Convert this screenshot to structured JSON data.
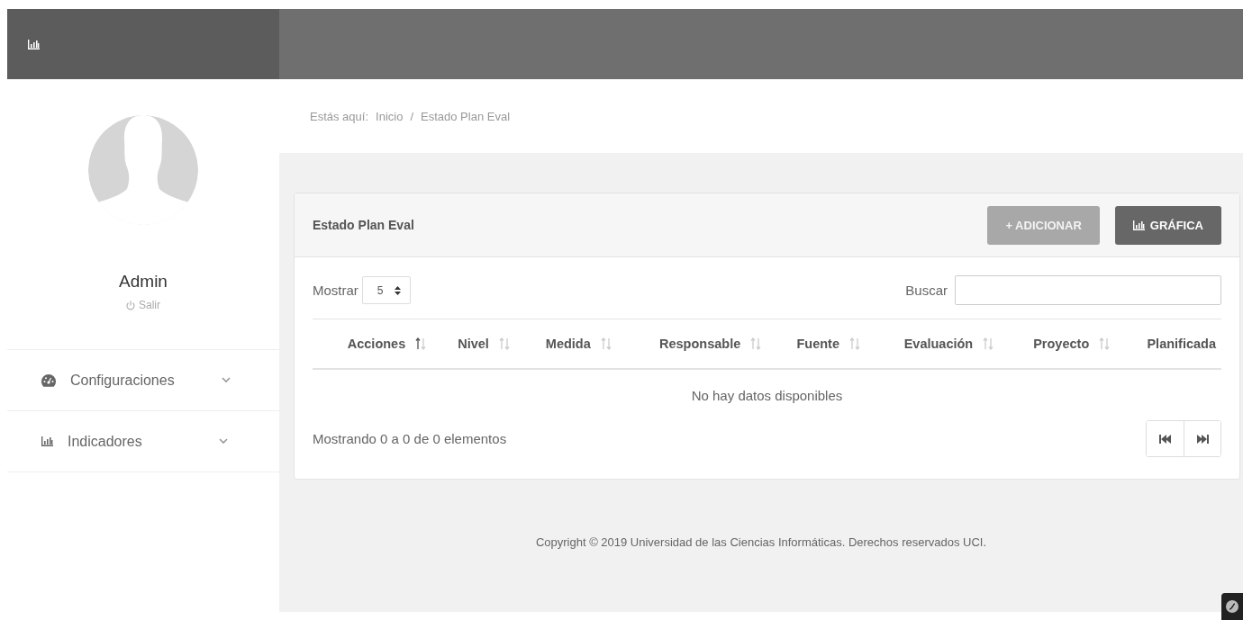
{
  "sidebar": {
    "user": {
      "name": "Admin",
      "logout": "Salir"
    },
    "items": [
      {
        "label": "Configuraciones",
        "expanded": false
      },
      {
        "label": "Indicadores",
        "expanded": false
      }
    ]
  },
  "breadcrumb": {
    "prefix": "Estás aquí:",
    "items": [
      "Inicio",
      "Estado Plan Eval"
    ],
    "separator": "/"
  },
  "card": {
    "title": "Estado Plan Eval",
    "buttons": [
      {
        "label": "+ ADICIONAR",
        "kind": "add"
      },
      {
        "label": "GRÁFICA",
        "kind": "chart"
      }
    ],
    "length": {
      "label": "Mostrar",
      "value": "5"
    },
    "search": {
      "label": "Buscar"
    },
    "columns": [
      {
        "label": "Acciones",
        "sortable": true,
        "sorted": true
      },
      {
        "label": "Nivel",
        "sortable": true,
        "sorted": false
      },
      {
        "label": "Medida",
        "sortable": true,
        "sorted": false
      },
      {
        "label": "Responsable",
        "sortable": true,
        "sorted": false
      },
      {
        "label": "Fuente",
        "sortable": true,
        "sorted": false
      },
      {
        "label": "Evaluación",
        "sortable": true,
        "sorted": false
      },
      {
        "label": "Proyecto",
        "sortable": true,
        "sorted": false
      },
      {
        "label": "Planificada",
        "sortable": false
      }
    ],
    "empty_message": "No hay datos disponibles",
    "info": "Mostrando 0 a 0 de 0 elementos"
  },
  "footer": "Copyright © 2019 Universidad de las Ciencias Informáticas. Derechos reservados UCI."
}
